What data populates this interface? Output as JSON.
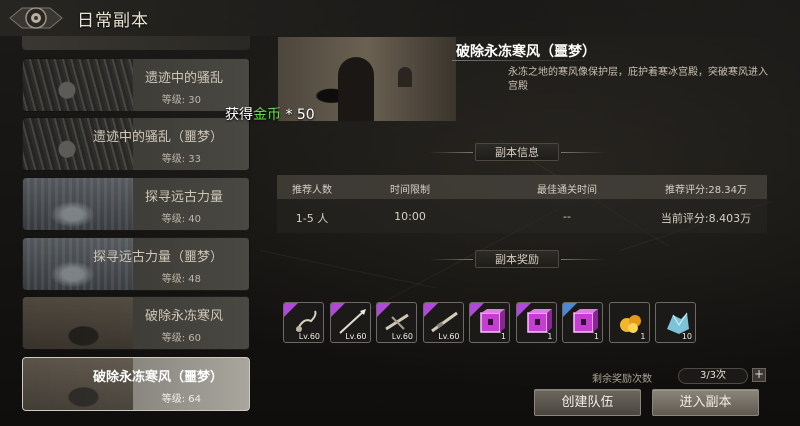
{
  "window": {
    "title": "日常副本"
  },
  "dungeons": [
    {
      "name": "遗迹中的骚乱",
      "level": "等级: 30",
      "thumb": "ruins"
    },
    {
      "name": "遗迹中的骚乱（噩梦）",
      "level": "等级: 33",
      "thumb": "ruins"
    },
    {
      "name": "探寻远古力量",
      "level": "等级: 40",
      "thumb": "frost"
    },
    {
      "name": "探寻远古力量（噩梦）",
      "level": "等级: 48",
      "thumb": "frost"
    },
    {
      "name": "破除永冻寒风",
      "level": "等级: 60",
      "thumb": "hall"
    },
    {
      "name": "破除永冻寒风（噩梦）",
      "level": "等级: 64",
      "thumb": "hall",
      "selected": true
    }
  ],
  "reward_note": {
    "prefix": "获得",
    "currency": "金币",
    "suffix": " * 50"
  },
  "detail": {
    "title": "破除永冻寒风（噩梦）",
    "description": "永冻之地的寒风像保护层，庇护着寒冰宫殿，突破寒风进入宫殿"
  },
  "info_section": {
    "label": "副本信息",
    "headers": [
      "推荐人数",
      "时间限制",
      "最佳通关时间",
      "推荐评分:28.34万"
    ],
    "values": [
      "1-5 人",
      "10:00",
      "--",
      "当前评分:8.403万"
    ]
  },
  "reward_section": {
    "label": "副本奖励"
  },
  "reward_items": [
    {
      "icon": "scorpion-icon",
      "rarity": "purple",
      "qty": "Lv.60"
    },
    {
      "icon": "spear-icon",
      "rarity": "purple",
      "qty": "Lv.60"
    },
    {
      "icon": "crossbow-icon",
      "rarity": "purple",
      "qty": "Lv.60"
    },
    {
      "icon": "rifle-icon",
      "rarity": "purple",
      "qty": "Lv.60"
    },
    {
      "icon": "magic-cube-icon",
      "rarity": "purple",
      "qty": "1"
    },
    {
      "icon": "magic-cube-icon",
      "rarity": "purple",
      "qty": "1"
    },
    {
      "icon": "magic-cube-icon",
      "rarity": "blue",
      "qty": "1"
    },
    {
      "icon": "gold-ore-icon",
      "rarity": "none",
      "qty": "1"
    },
    {
      "icon": "crystal-ore-icon",
      "rarity": "none",
      "qty": "10"
    }
  ],
  "remaining": {
    "label": "剩余奖励次数",
    "value": "3/3次",
    "plus": "+"
  },
  "buttons": {
    "create_team": "创建队伍",
    "enter_dungeon": "进入副本"
  },
  "colors": {
    "gold_text": "#67dc4b",
    "purple_rarity": "#b049d8",
    "blue_rarity": "#4f86d6"
  }
}
